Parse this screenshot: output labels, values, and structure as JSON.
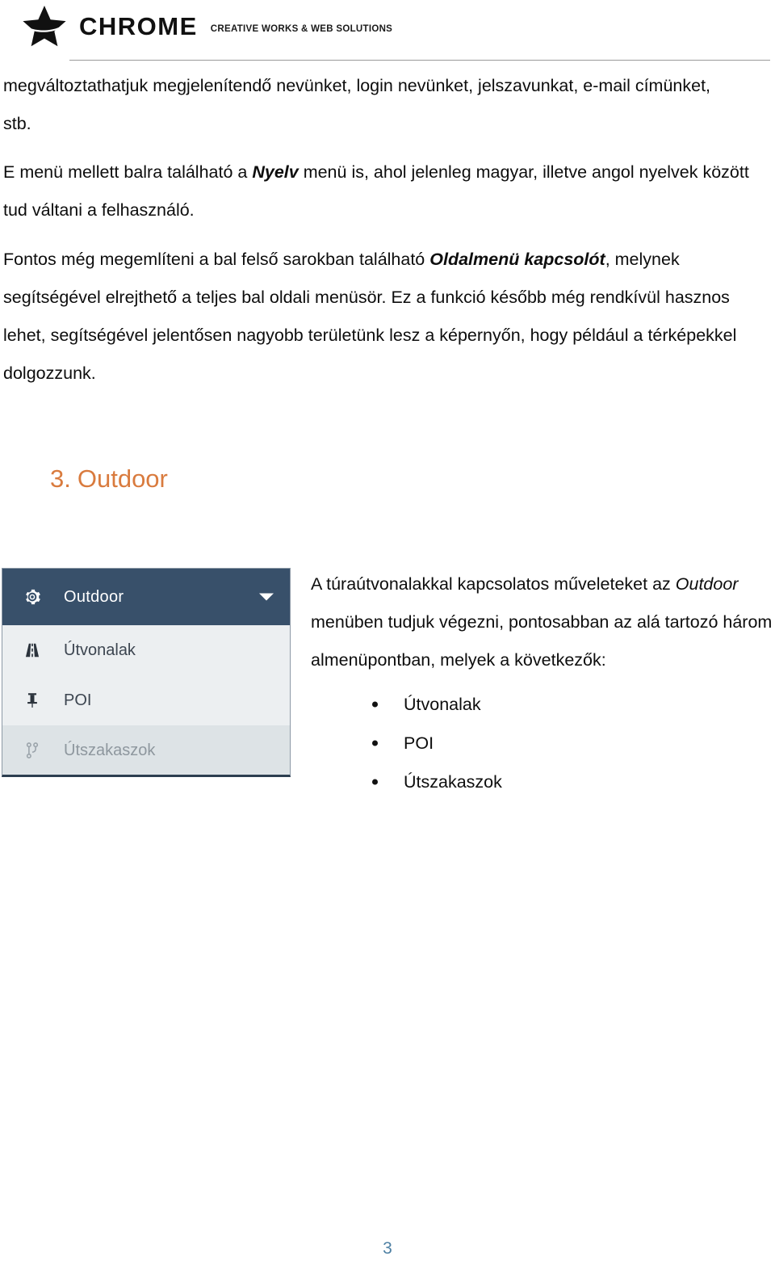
{
  "header": {
    "logo_icon": "star-logo-icon",
    "brand": "CHROME",
    "tagline": "CREATIVE WORKS  & WEB SOLUTIONS"
  },
  "body": {
    "paragraph_1": {
      "text": "megváltoztathatjuk megjelenítendő nevünket, login nevünket, jelszavunkat, e-mail címünket, stb."
    },
    "paragraph_2": {
      "before": "E menü mellett balra található a ",
      "emphasis": "Nyelv",
      "after": " menü is, ahol jelenleg magyar, illetve angol nyelvek között tud váltani a felhasználó."
    },
    "paragraph_3": {
      "before": "Fontos még megemlíteni a bal felső sarokban található ",
      "emphasis": "Oldalmenü kapcsolót",
      "after": ", melynek segítségével elrejthető a teljes bal oldali menüsör. Ez a funkció később még rendkívül hasznos lehet, segítségével jelentősen nagyobb területünk lesz a képernyőn, hogy például a térképekkel dolgozzunk."
    }
  },
  "section": {
    "number": "3.",
    "title": "Outdoor",
    "color": "#D97B3E"
  },
  "menu_screenshot": {
    "header": {
      "icon": "gear-icon",
      "label": "Outdoor",
      "caret": "chevron-down-icon",
      "background": "#38506a"
    },
    "items": [
      {
        "icon": "road-icon",
        "label": "Útvonalak",
        "selected": false
      },
      {
        "icon": "pin-icon",
        "label": "POI",
        "selected": false
      },
      {
        "icon": "branch-icon",
        "label": "Útszakaszok",
        "selected": true
      }
    ]
  },
  "right_column": {
    "before": "A túraútvonalakkal kapcsolatos műveleteket az ",
    "emphasis": "Outdoor",
    "after": " menüben tudjuk végezni, pontosabban az alá tartozó három almenüpontban, melyek a következők:"
  },
  "bullets": [
    "Útvonalak",
    "POI",
    "Útszakaszok"
  ],
  "footer": {
    "page_number": "3"
  }
}
